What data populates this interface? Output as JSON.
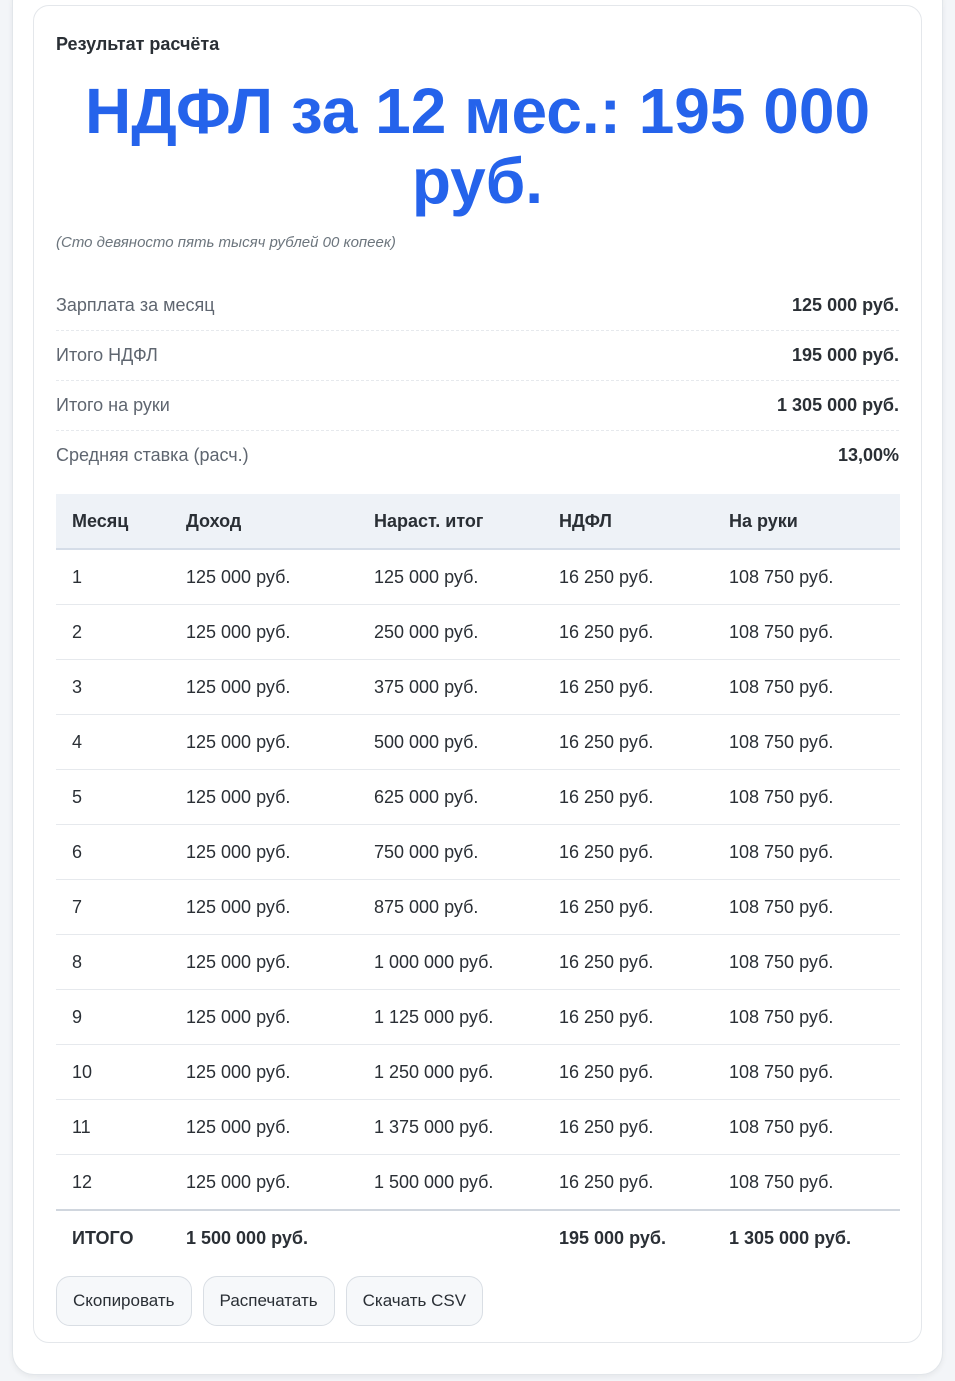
{
  "result": {
    "title": "Результат расчёта",
    "headline": "НДФЛ за 12 мес.: 195 000 руб.",
    "amount_in_words": "(Сто девяносто пять тысяч рублей 00 копеек)"
  },
  "summary": [
    {
      "label": "Зарплата за месяц",
      "value": "125 000 руб."
    },
    {
      "label": "Итого НДФЛ",
      "value": "195 000 руб."
    },
    {
      "label": "Итого на руки",
      "value": "1 305 000 руб."
    },
    {
      "label": "Средняя ставка (расч.)",
      "value": "13,00%"
    }
  ],
  "table": {
    "headers": [
      "Месяц",
      "Доход",
      "Нараст. итог",
      "НДФЛ",
      "На руки"
    ],
    "rows": [
      [
        "1",
        "125 000 руб.",
        "125 000 руб.",
        "16 250 руб.",
        "108 750 руб."
      ],
      [
        "2",
        "125 000 руб.",
        "250 000 руб.",
        "16 250 руб.",
        "108 750 руб."
      ],
      [
        "3",
        "125 000 руб.",
        "375 000 руб.",
        "16 250 руб.",
        "108 750 руб."
      ],
      [
        "4",
        "125 000 руб.",
        "500 000 руб.",
        "16 250 руб.",
        "108 750 руб."
      ],
      [
        "5",
        "125 000 руб.",
        "625 000 руб.",
        "16 250 руб.",
        "108 750 руб."
      ],
      [
        "6",
        "125 000 руб.",
        "750 000 руб.",
        "16 250 руб.",
        "108 750 руб."
      ],
      [
        "7",
        "125 000 руб.",
        "875 000 руб.",
        "16 250 руб.",
        "108 750 руб."
      ],
      [
        "8",
        "125 000 руб.",
        "1 000 000 руб.",
        "16 250 руб.",
        "108 750 руб."
      ],
      [
        "9",
        "125 000 руб.",
        "1 125 000 руб.",
        "16 250 руб.",
        "108 750 руб."
      ],
      [
        "10",
        "125 000 руб.",
        "1 250 000 руб.",
        "16 250 руб.",
        "108 750 руб."
      ],
      [
        "11",
        "125 000 руб.",
        "1 375 000 руб.",
        "16 250 руб.",
        "108 750 руб."
      ],
      [
        "12",
        "125 000 руб.",
        "1 500 000 руб.",
        "16 250 руб.",
        "108 750 руб."
      ]
    ],
    "total": [
      "ИТОГО",
      "1 500 000 руб.",
      "",
      "195 000 руб.",
      "1 305 000 руб."
    ]
  },
  "actions": {
    "copy_label": "Скопировать",
    "print_label": "Распечатать",
    "csv_label": "Скачать CSV"
  },
  "colors": {
    "accent": "#2563eb"
  }
}
